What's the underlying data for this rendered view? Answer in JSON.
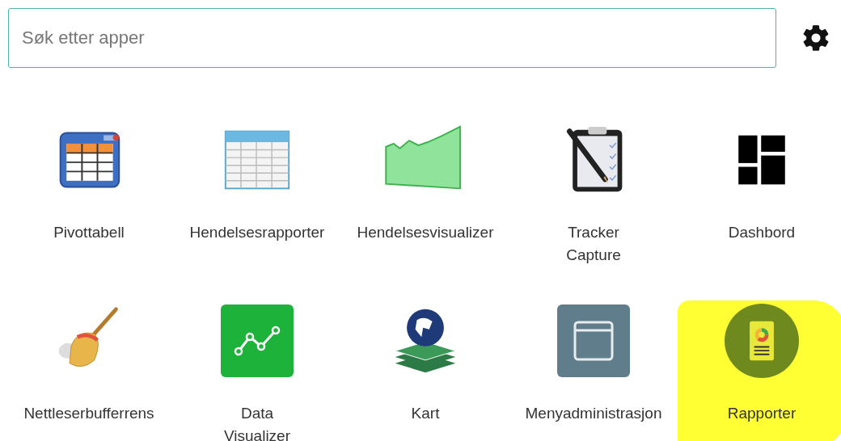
{
  "search": {
    "placeholder": "Søk etter apper"
  },
  "apps": [
    {
      "label": "Pivottabell",
      "kind": "pivot",
      "hovered": false,
      "highlighted": false
    },
    {
      "label": "Hendelsesrapporter",
      "kind": "table",
      "hovered": false,
      "highlighted": false
    },
    {
      "label": "Hendelsesvisualizer",
      "kind": "area",
      "hovered": false,
      "highlighted": false
    },
    {
      "label": "Tracker Capture",
      "kind": "clipboard",
      "hovered": false,
      "highlighted": false
    },
    {
      "label": "Dashbord",
      "kind": "dashboard",
      "hovered": false,
      "highlighted": false
    },
    {
      "label": "Nettleserbufferrens",
      "kind": "broom",
      "hovered": false,
      "highlighted": false
    },
    {
      "label": "Data Visualizer",
      "kind": "linechart",
      "hovered": false,
      "highlighted": false
    },
    {
      "label": "Kart",
      "kind": "map",
      "hovered": false,
      "highlighted": false
    },
    {
      "label": "Menyadministrasjon",
      "kind": "window",
      "hovered": false,
      "highlighted": false
    },
    {
      "label": "Rapporter",
      "kind": "report",
      "hovered": true,
      "highlighted": true
    }
  ]
}
